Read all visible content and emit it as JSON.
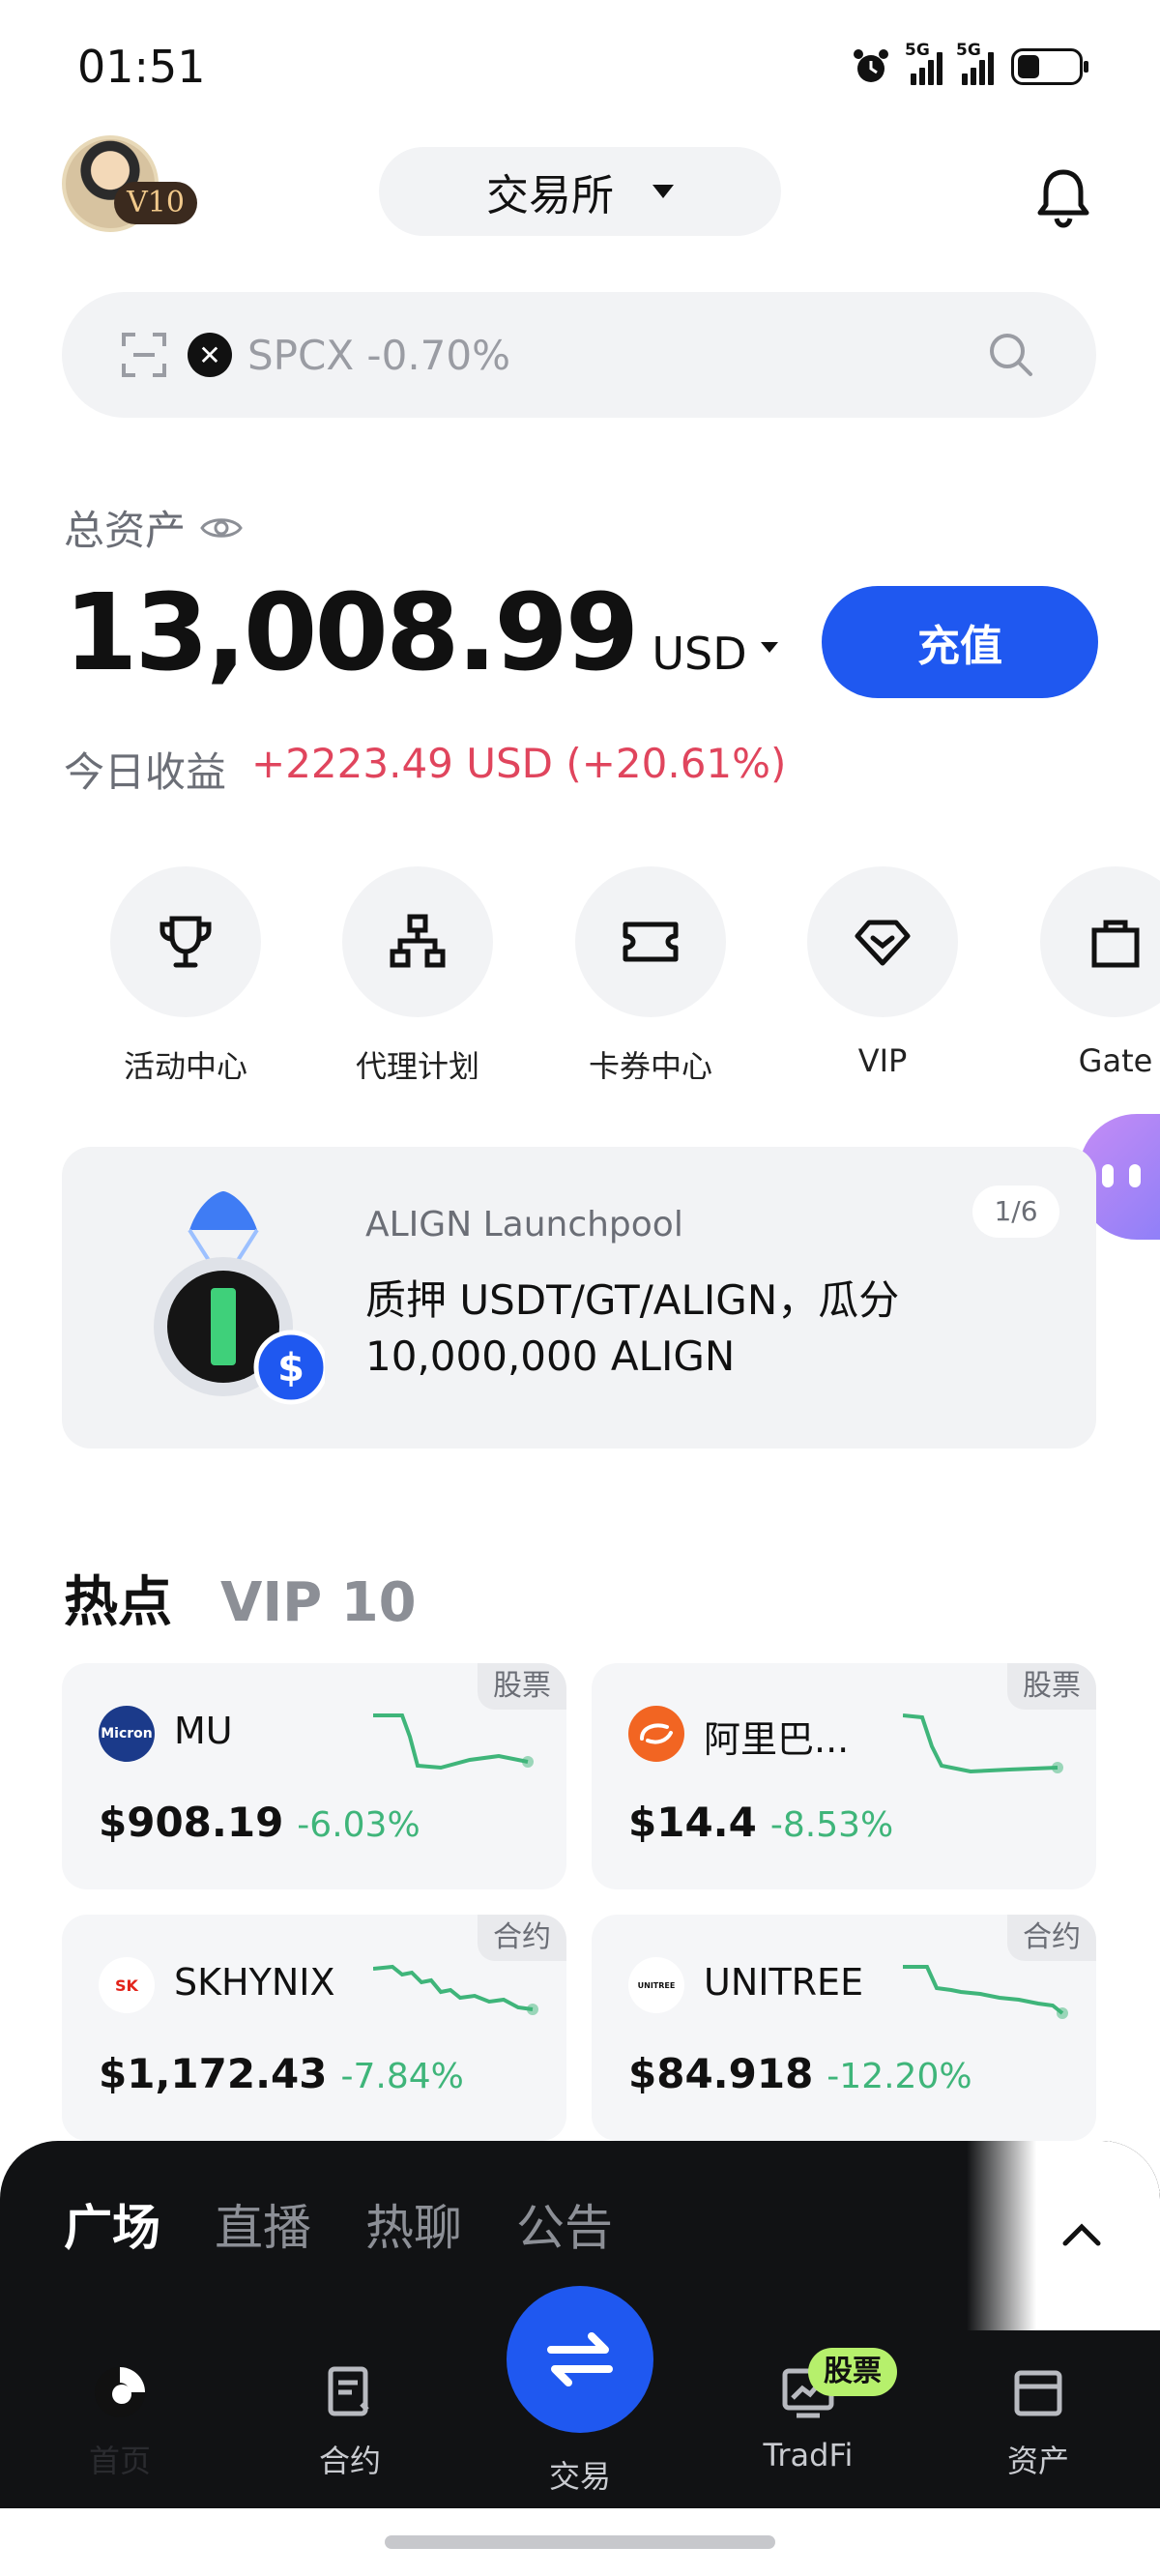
{
  "status_bar": {
    "time": "01:51",
    "net1": "5G",
    "net2": "5G"
  },
  "header": {
    "vip_badge": "V10",
    "exchange_label": "交易所"
  },
  "search": {
    "placeholder": "SPCX -0.70%"
  },
  "assets": {
    "label": "总资产",
    "total": "13,008.99",
    "currency": "USD",
    "deposit_label": "充值",
    "today_label": "今日收益",
    "today_value": "+2223.49 USD (+20.61%)"
  },
  "shortcuts": [
    {
      "label": "活动中心",
      "icon": "trophy-icon"
    },
    {
      "label": "代理计划",
      "icon": "org-chart-icon"
    },
    {
      "label": "卡券中心",
      "icon": "ticket-icon"
    },
    {
      "label": "VIP",
      "icon": "diamond-icon"
    },
    {
      "label": "Gate",
      "icon": "bag-icon"
    }
  ],
  "banner": {
    "tag": "ALIGN Launchpool",
    "title": "质押 USDT/GT/ALIGN，瓜分 10,000,000 ALIGN",
    "pager": "1/6"
  },
  "hot": {
    "tab_active": "热点",
    "tab_other": "VIP 10"
  },
  "cards": [
    {
      "symbol": "MU",
      "badge": "股票",
      "price": "$908.19",
      "change": "-6.03%",
      "logo_text": "Micron",
      "logo_color": "#1b3a8a"
    },
    {
      "symbol": "阿里巴...",
      "badge": "股票",
      "price": "$14.4",
      "change": "-8.53%",
      "logo_text": "",
      "logo_color": "#f26522"
    },
    {
      "symbol": "SKHYNIX",
      "badge": "合约",
      "price": "$1,172.43",
      "change": "-7.84%",
      "logo_text": "SK",
      "logo_color": "#ffffff"
    },
    {
      "symbol": "UNITREE",
      "badge": "合约",
      "price": "$84.918",
      "change": "-12.20%",
      "logo_text": "UNITREE",
      "logo_color": "#ffffff"
    }
  ],
  "feed_tabs": [
    "广场",
    "直播",
    "热聊",
    "公告"
  ],
  "tabbar": {
    "home": "首页",
    "contract": "合约",
    "trade": "交易",
    "tradfi": "TradFi",
    "tradfi_badge": "股票",
    "assets": "资产"
  },
  "colors": {
    "accent": "#1f58f0",
    "up": "#e0455d",
    "down": "#3fb57a"
  }
}
